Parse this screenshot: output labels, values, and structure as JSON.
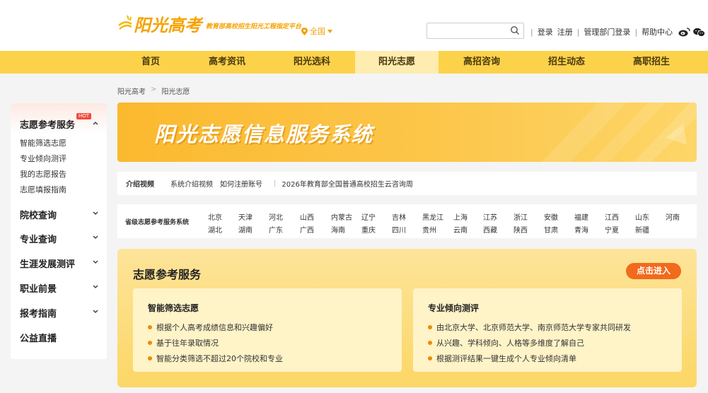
{
  "header": {
    "logo_text": "阳光高考",
    "logo_slogan": "教育部高校招生阳光工程指定平台",
    "region": "全国",
    "search": {
      "placeholder": ""
    },
    "links": {
      "login": "登录",
      "register": "注册",
      "admin_login": "管理部门登录",
      "help": "帮助中心"
    }
  },
  "nav": {
    "items": [
      {
        "label": "首页"
      },
      {
        "label": "高考资讯"
      },
      {
        "label": "阳光选科"
      },
      {
        "label": "阳光志愿"
      },
      {
        "label": "高招咨询"
      },
      {
        "label": "招生动态"
      },
      {
        "label": "高职招生"
      }
    ]
  },
  "breadcrumb": [
    "阳光高考",
    "阳光志愿"
  ],
  "sidebar": {
    "groups": [
      {
        "title": "志愿参考服务",
        "badge": "HOT",
        "items": [
          "智能筛选志愿",
          "专业倾向测评",
          "我的志愿报告",
          "志愿填报指南"
        ]
      },
      {
        "title": "院校查询"
      },
      {
        "title": "专业查询"
      },
      {
        "title": "生涯发展测评"
      },
      {
        "title": "职业前景"
      },
      {
        "title": "报考指南"
      },
      {
        "title": "公益直播"
      }
    ]
  },
  "banner": {
    "title": "阳光志愿信息服务系统"
  },
  "intro": {
    "label": "介绍视频",
    "links": [
      "系统介绍视频",
      "如何注册账号"
    ],
    "event": "2026年教育部全国普通高校招生云咨询周"
  },
  "provinces": {
    "label": "省级志愿参考服务系统",
    "row1": [
      "北京",
      "天津",
      "河北",
      "山西",
      "内蒙古",
      "辽宁",
      "吉林",
      "黑龙江",
      "上海",
      "江苏",
      "浙江",
      "安徽",
      "福建",
      "江西",
      "山东",
      "河南"
    ],
    "row2": [
      "湖北",
      "湖南",
      "广东",
      "广西",
      "海南",
      "重庆",
      "四川",
      "贵州",
      "云南",
      "西藏",
      "陕西",
      "甘肃",
      "青海",
      "宁夏",
      "新疆"
    ]
  },
  "service": {
    "title": "志愿参考服务",
    "enter_label": "点击进入",
    "cards": [
      {
        "title": "智能筛选志愿",
        "features": [
          "根据个人高考成绩信息和兴趣偏好",
          "基于往年录取情况",
          "智能分类筛选不超过20个院校和专业"
        ]
      },
      {
        "title": "专业倾向测评",
        "features": [
          "由北京大学、北京师范大学、南京师范大学专家共同研发",
          "从兴趣、学科倾向、人格等多维度了解自己",
          "根据测评结果一键生成个人专业倾向清单"
        ]
      }
    ]
  }
}
